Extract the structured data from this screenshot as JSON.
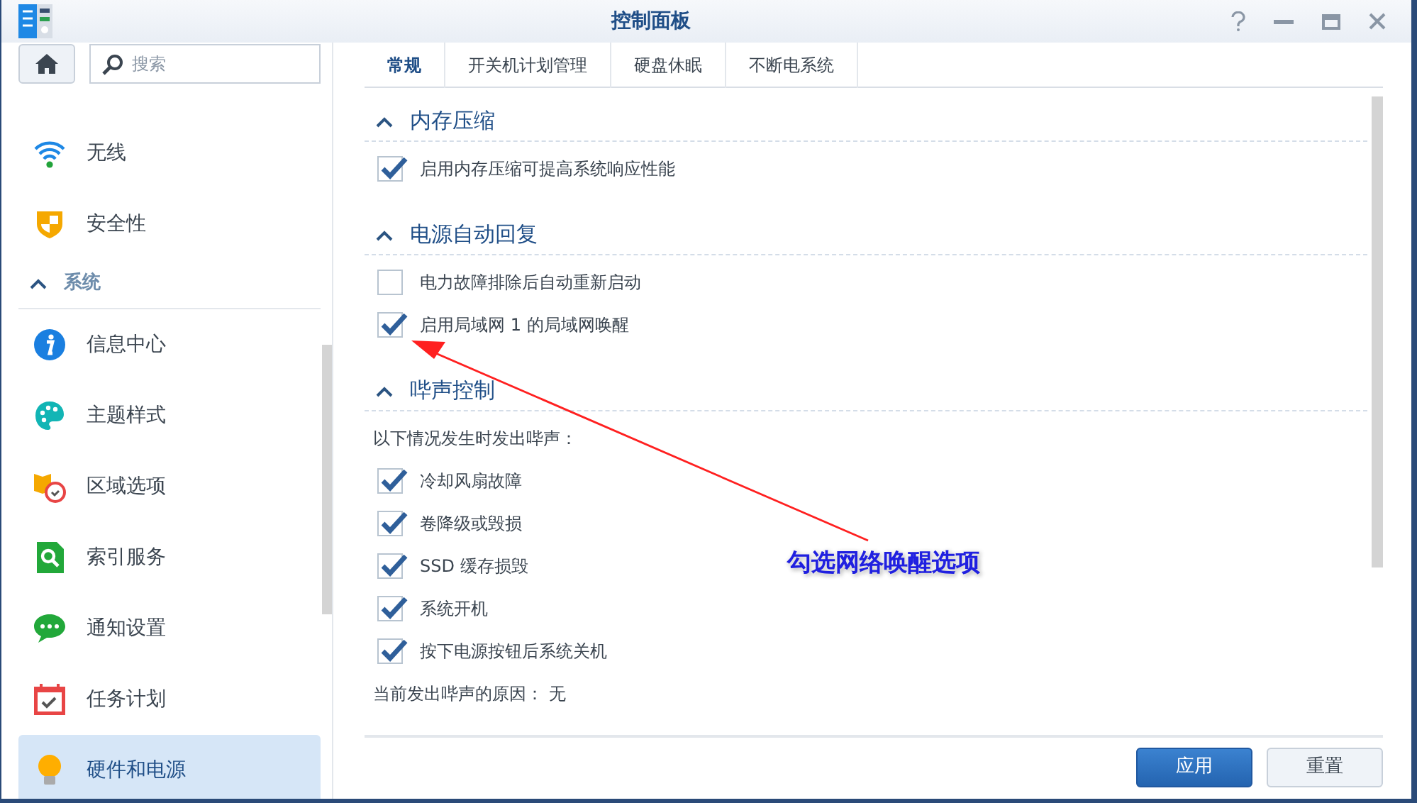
{
  "window": {
    "title": "控制面板"
  },
  "sidebar": {
    "search": {
      "placeholder": "搜索"
    },
    "items": [
      {
        "kind": "item",
        "label": "无线",
        "selected": false
      },
      {
        "kind": "item",
        "label": "安全性",
        "selected": false
      },
      {
        "kind": "header",
        "label": "系统",
        "expanded": true
      },
      {
        "kind": "item",
        "label": "信息中心",
        "selected": false
      },
      {
        "kind": "item",
        "label": "主题样式",
        "selected": false
      },
      {
        "kind": "item",
        "label": "区域选项",
        "selected": false
      },
      {
        "kind": "item",
        "label": "索引服务",
        "selected": false
      },
      {
        "kind": "item",
        "label": "通知设置",
        "selected": false
      },
      {
        "kind": "item",
        "label": "任务计划",
        "selected": false
      },
      {
        "kind": "item",
        "label": "硬件和电源",
        "selected": true
      }
    ]
  },
  "tabs": [
    {
      "label": "常规",
      "selected": true
    },
    {
      "label": "开关机计划管理",
      "selected": false
    },
    {
      "label": "硬盘休眠",
      "selected": false
    },
    {
      "label": "不断电系统",
      "selected": false
    }
  ],
  "sections": [
    {
      "title": "内存压缩",
      "expanded": true,
      "rows": [
        {
          "kind": "checkbox",
          "label": "启用内存压缩可提高系统响应性能",
          "checked": true
        }
      ]
    },
    {
      "title": "电源自动回复",
      "expanded": true,
      "rows": [
        {
          "kind": "checkbox",
          "label": "电力故障排除后自动重新启动",
          "checked": false
        },
        {
          "kind": "checkbox",
          "label": "启用局域网 1 的局域网唤醒",
          "checked": true
        }
      ]
    },
    {
      "title": "哔声控制",
      "expanded": true,
      "rows": [
        {
          "kind": "text",
          "label": "以下情况发生时发出哔声："
        },
        {
          "kind": "checkbox",
          "label": "冷却风扇故障",
          "checked": true
        },
        {
          "kind": "checkbox",
          "label": "卷降级或毁损",
          "checked": true
        },
        {
          "kind": "checkbox",
          "label": "SSD 缓存损毁",
          "checked": true
        },
        {
          "kind": "checkbox",
          "label": "系统开机",
          "checked": true
        },
        {
          "kind": "checkbox",
          "label": "按下电源按钮后系统关机",
          "checked": true
        },
        {
          "kind": "text",
          "label": "当前发出哔声的原因： 无"
        }
      ]
    }
  ],
  "annotation": {
    "label": "勾选网络唤醒选项"
  },
  "buttons": [
    {
      "label": "应用",
      "kind": "primary"
    },
    {
      "label": "重置",
      "kind": "secondary"
    }
  ]
}
